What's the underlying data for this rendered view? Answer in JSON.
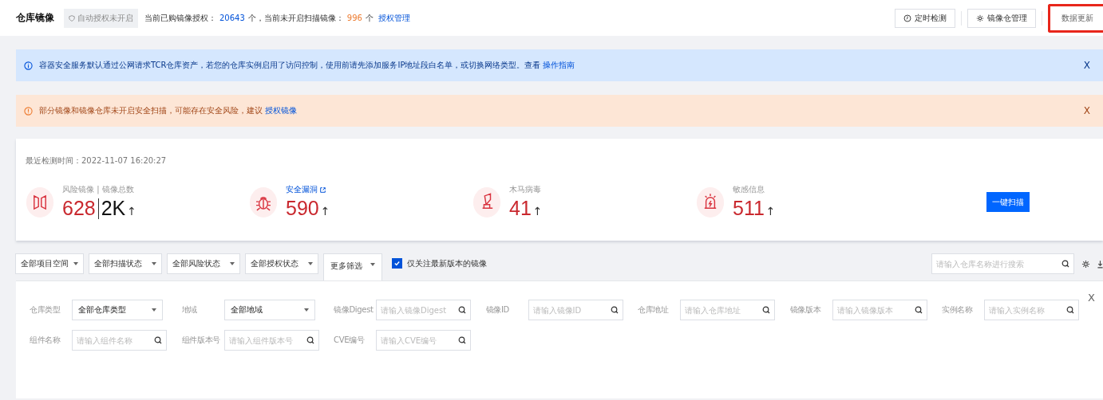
{
  "header": {
    "title": "仓库镜像",
    "auto_badge": "自动授权未开启",
    "summary": [
      {
        "kind": "text",
        "text": "当前已购镜像授权："
      },
      {
        "kind": "blue",
        "text": "20643"
      },
      {
        "kind": "text",
        "text": "个，当前未开启扫描镜像："
      },
      {
        "kind": "orange",
        "text": "996"
      },
      {
        "kind": "text",
        "text": "个"
      },
      {
        "kind": "link",
        "text": "授权管理"
      }
    ],
    "buttons": [
      {
        "label": "定时检测",
        "highlighted": false
      },
      {
        "label": "镜像仓管理",
        "highlighted": false
      },
      {
        "label": "数据更新",
        "highlighted": true
      }
    ]
  },
  "notices": [
    {
      "kind": "info",
      "text": "容器安全服务默认通过公网请求TCR仓库资产，若您的仓库实例启用了访问控制，使用前请先添加服务IP地址段白名单，或切换网络类型。查看",
      "link": "操作指南",
      "close": "X"
    },
    {
      "kind": "warning",
      "text": "部分镜像和镜像仓库未开启安全扫描，可能存在安全风险，建议",
      "link": "授权镜像",
      "close": "X"
    }
  ],
  "overview": {
    "last_check": "最近检测时间：2022-11-07 16:20:27",
    "scan_button": "一键扫描",
    "stats": [
      {
        "label": "风险镜像 | 镜像总数",
        "link": false,
        "value": "628",
        "total": "2K",
        "arrow": "↑"
      },
      {
        "label": "安全漏洞",
        "link": true,
        "value": "590",
        "arrow": "↑"
      },
      {
        "label": "木马病毒",
        "link": false,
        "value": "41",
        "arrow": "↑"
      },
      {
        "label": "敏感信息",
        "link": false,
        "value": "511",
        "arrow": "↑"
      }
    ]
  },
  "toolbar": {
    "selects": [
      {
        "label": "全部项目空间",
        "wide": false
      },
      {
        "label": "全部扫描状态",
        "wide": true
      },
      {
        "label": "全部风险状态",
        "wide": true
      },
      {
        "label": "全部授权状态",
        "wide": true
      }
    ],
    "more_filter": {
      "label": "更多筛选",
      "expanded": true
    },
    "latest_only": {
      "label": "仅关注最新版本的镜像",
      "checked": true
    },
    "search": {
      "placeholder": "请输入仓库名称进行搜索"
    }
  },
  "filter_panel": {
    "close": "X",
    "fields": [
      {
        "label": "仓库类型",
        "kind": "select",
        "value": "全部仓库类型"
      },
      {
        "label": "地域",
        "kind": "select",
        "value": "全部地域"
      },
      {
        "label": "镜像Digest",
        "kind": "search",
        "placeholder": "请输入镜像Digest"
      },
      {
        "label": "镜像ID",
        "kind": "search",
        "placeholder": "请输入镜像ID"
      },
      {
        "label": "仓库地址",
        "kind": "search",
        "placeholder": "请输入仓库地址"
      },
      {
        "label": "镜像版本",
        "kind": "search",
        "placeholder": "请输入镜像版本"
      },
      {
        "label": "实例名称",
        "kind": "search",
        "placeholder": "请输入实例名称"
      },
      {
        "label": "组件名称",
        "kind": "search",
        "placeholder": "请输入组件名称"
      },
      {
        "label": "组件版本号",
        "kind": "search",
        "placeholder": "请输入组件版本号"
      },
      {
        "label": "CVE编号",
        "kind": "search",
        "placeholder": "请输入CVE编号"
      }
    ]
  }
}
